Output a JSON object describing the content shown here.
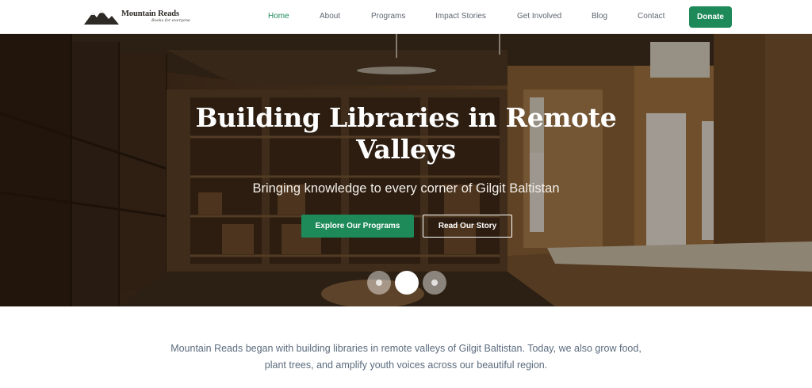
{
  "brand": {
    "name": "Mountain Reads",
    "tagline": "Books for everyone"
  },
  "nav": {
    "items": [
      {
        "label": "Home",
        "active": true
      },
      {
        "label": "About",
        "active": false
      },
      {
        "label": "Programs",
        "active": false
      },
      {
        "label": "Impact Stories",
        "active": false
      },
      {
        "label": "Get Involved",
        "active": false
      },
      {
        "label": "Blog",
        "active": false
      },
      {
        "label": "Contact",
        "active": false
      }
    ],
    "donate_label": "Donate"
  },
  "hero": {
    "title": "Building Libraries in Remote Valleys",
    "subtitle": "Bringing knowledge to every corner of Gilgit Baltistan",
    "primary_button": "Explore Our Programs",
    "secondary_button": "Read Our Story",
    "slides": 3,
    "active_slide": 2
  },
  "intro": {
    "text": "Mountain Reads began with building libraries in remote valleys of Gilgit Baltistan. Today, we also grow food, plant trees, and amplify youth voices across our beautiful region."
  },
  "colors": {
    "accent": "#1e8a5a",
    "nav_text": "#5e6570",
    "intro_text": "#5b6b7d"
  }
}
